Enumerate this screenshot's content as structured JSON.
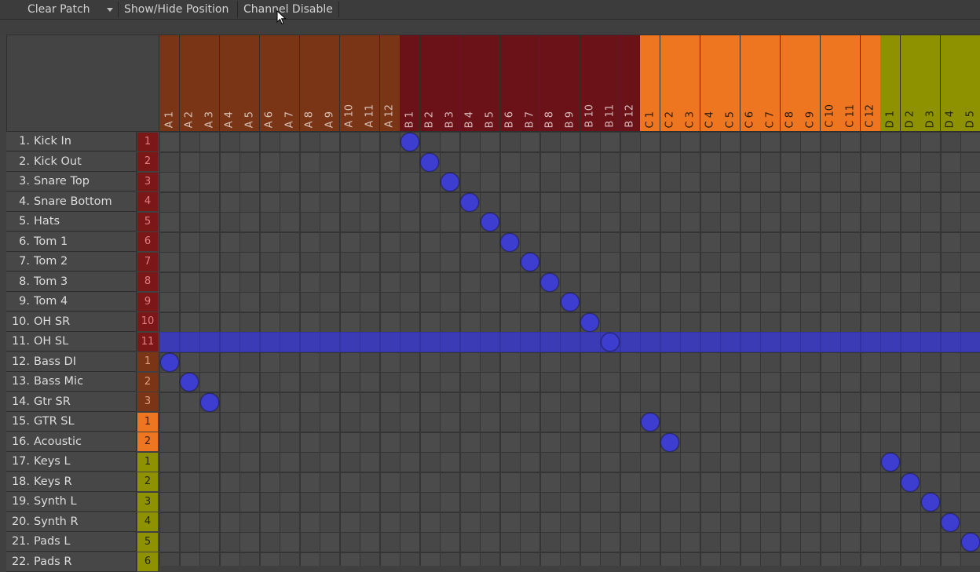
{
  "toolbar": {
    "clear_patch_label": "Clear Patch",
    "show_hide_label": "Show/Hide Position",
    "channel_disable_label": "Channel Disable"
  },
  "colors": {
    "group_a": "#7a3416",
    "group_b": "#6b1219",
    "group_c": "#ee7621",
    "group_d": "#8e9100",
    "selection": "#3b3bb6",
    "patch_dot": "#3d3dcf",
    "badge_red": "#7c1718"
  },
  "column_groups": [
    {
      "prefix": "A",
      "count": 12,
      "color": "#7a3416",
      "text_color": "#d8c0b4"
    },
    {
      "prefix": "B",
      "count": 12,
      "color": "#6b1219",
      "text_color": "#d8b8b8"
    },
    {
      "prefix": "C",
      "count": 12,
      "color": "#ee7621",
      "text_color": "#2a1a08"
    },
    {
      "prefix": "D",
      "count": 5,
      "color": "#8e9100",
      "text_color": "#22240a"
    }
  ],
  "columns": [
    "A 1",
    "A 2",
    "A 3",
    "A 4",
    "A 5",
    "A 6",
    "A 7",
    "A 8",
    "A 9",
    "A 10",
    "A 11",
    "A 12",
    "B 1",
    "B 2",
    "B 3",
    "B 4",
    "B 5",
    "B 6",
    "B 7",
    "B 8",
    "B 9",
    "B 10",
    "B 11",
    "B 12",
    "C 1",
    "C 2",
    "C 3",
    "C 4",
    "C 5",
    "C 6",
    "C 7",
    "C 8",
    "C 9",
    "C 10",
    "C 11",
    "C 12",
    "D 1",
    "D 2",
    "D 3",
    "D 4",
    "D 5"
  ],
  "rows": [
    {
      "num": "1.",
      "label": "Kick In",
      "badge": "1",
      "badge_color": "#7c1718",
      "badge_text": "#e08080",
      "patch": "B 1"
    },
    {
      "num": "2.",
      "label": "Kick Out",
      "badge": "2",
      "badge_color": "#7c1718",
      "badge_text": "#e08080",
      "patch": "B 2"
    },
    {
      "num": "3.",
      "label": "Snare Top",
      "badge": "3",
      "badge_color": "#7c1718",
      "badge_text": "#e08080",
      "patch": "B 3"
    },
    {
      "num": "4.",
      "label": "Snare Bottom",
      "badge": "4",
      "badge_color": "#7c1718",
      "badge_text": "#e08080",
      "patch": "B 4"
    },
    {
      "num": "5.",
      "label": "Hats",
      "badge": "5",
      "badge_color": "#7c1718",
      "badge_text": "#e08080",
      "patch": "B 5"
    },
    {
      "num": "6.",
      "label": "Tom 1",
      "badge": "6",
      "badge_color": "#7c1718",
      "badge_text": "#e08080",
      "patch": "B 6"
    },
    {
      "num": "7.",
      "label": "Tom 2",
      "badge": "7",
      "badge_color": "#7c1718",
      "badge_text": "#e08080",
      "patch": "B 7"
    },
    {
      "num": "8.",
      "label": "Tom 3",
      "badge": "8",
      "badge_color": "#7c1718",
      "badge_text": "#e08080",
      "patch": "B 8"
    },
    {
      "num": "9.",
      "label": "Tom 4",
      "badge": "9",
      "badge_color": "#7c1718",
      "badge_text": "#e08080",
      "patch": "B 9"
    },
    {
      "num": "10.",
      "label": "OH SR",
      "badge": "10",
      "badge_color": "#7c1718",
      "badge_text": "#e08080",
      "patch": "B 10"
    },
    {
      "num": "11.",
      "label": "OH SL",
      "badge": "11",
      "badge_color": "#7c1718",
      "badge_text": "#e08080",
      "patch": "B 11",
      "selected": true
    },
    {
      "num": "12.",
      "label": "Bass DI",
      "badge": "1",
      "badge_color": "#7a3416",
      "badge_text": "#e0a080",
      "patch": "A 1"
    },
    {
      "num": "13.",
      "label": "Bass Mic",
      "badge": "2",
      "badge_color": "#7a3416",
      "badge_text": "#e0a080",
      "patch": "A 2"
    },
    {
      "num": "14.",
      "label": "Gtr SR",
      "badge": "3",
      "badge_color": "#7a3416",
      "badge_text": "#e0a080",
      "patch": "A 3"
    },
    {
      "num": "15.",
      "label": "GTR SL",
      "badge": "1",
      "badge_color": "#ee7621",
      "badge_text": "#3a1a04",
      "patch": "C 1"
    },
    {
      "num": "16.",
      "label": "Acoustic",
      "badge": "2",
      "badge_color": "#ee7621",
      "badge_text": "#3a1a04",
      "patch": "C 2"
    },
    {
      "num": "17.",
      "label": "Keys L",
      "badge": "1",
      "badge_color": "#8e9100",
      "badge_text": "#22240a",
      "patch": "D 1"
    },
    {
      "num": "18.",
      "label": "Keys R",
      "badge": "2",
      "badge_color": "#8e9100",
      "badge_text": "#22240a",
      "patch": "D 2"
    },
    {
      "num": "19.",
      "label": "Synth L",
      "badge": "3",
      "badge_color": "#8e9100",
      "badge_text": "#22240a",
      "patch": "D 3"
    },
    {
      "num": "20.",
      "label": "Synth R",
      "badge": "4",
      "badge_color": "#8e9100",
      "badge_text": "#22240a",
      "patch": "D 4"
    },
    {
      "num": "21.",
      "label": "Pads L",
      "badge": "5",
      "badge_color": "#8e9100",
      "badge_text": "#22240a",
      "patch": "D 5"
    },
    {
      "num": "22.",
      "label": "Pads R",
      "badge": "6",
      "badge_color": "#8e9100",
      "badge_text": "#22240a",
      "patch": ""
    }
  ]
}
